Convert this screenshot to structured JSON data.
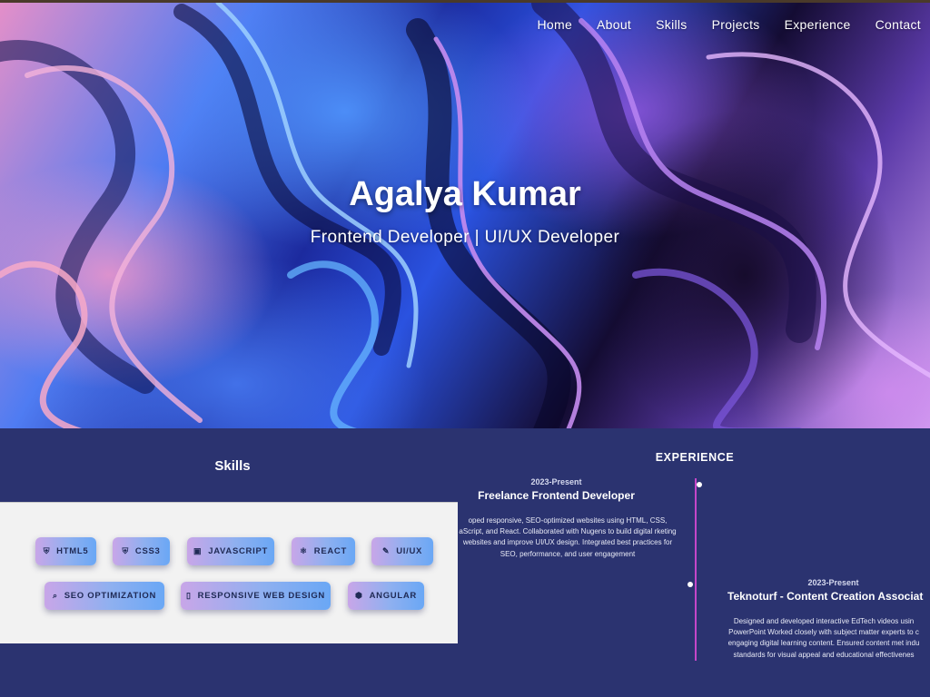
{
  "nav": {
    "items": [
      {
        "label": "Home"
      },
      {
        "label": "About"
      },
      {
        "label": "Skills"
      },
      {
        "label": "Projects"
      },
      {
        "label": "Experience"
      },
      {
        "label": "Contact"
      }
    ]
  },
  "hero": {
    "name": "Agalya Kumar",
    "subtitle": "Frontend Developer | UI/UX Developer"
  },
  "skills": {
    "title": "Skills",
    "items": [
      {
        "label": "HTML5",
        "icon": "html5-icon"
      },
      {
        "label": "CSS3",
        "icon": "css3-icon"
      },
      {
        "label": "JAVASCRIPT",
        "icon": "javascript-icon"
      },
      {
        "label": "REACT",
        "icon": "react-icon"
      },
      {
        "label": "UI/UX",
        "icon": "paintbrush-icon"
      },
      {
        "label": "SEO OPTIMIZATION",
        "icon": "search-icon"
      },
      {
        "label": "RESPONSIVE WEB DESIGN",
        "icon": "mobile-icon"
      },
      {
        "label": "ANGULAR",
        "icon": "angular-icon"
      }
    ]
  },
  "experience": {
    "title": "EXPERIENCE",
    "entries": [
      {
        "date": "2023-Present",
        "role": "Freelance Frontend Developer",
        "description": "oped responsive, SEO-optimized websites using HTML, CSS, aScript, and React. Collaborated with Nugens to build digital rketing websites and improve UI/UX design. Integrated best practices for SEO, performance, and user engagement"
      },
      {
        "date": "2023-Present",
        "role": "Teknoturf - Content Creation Associat",
        "description": "Designed and developed interactive EdTech videos usin PowerPoint Worked closely with subject matter experts to c engaging digital learning content. Ensured content met indu standards for visual appeal and educational effectivenes"
      }
    ]
  },
  "colors": {
    "page_background": "#2b3370",
    "timeline_line": "#c646c9",
    "skills_panel": "#f2f2f2"
  }
}
